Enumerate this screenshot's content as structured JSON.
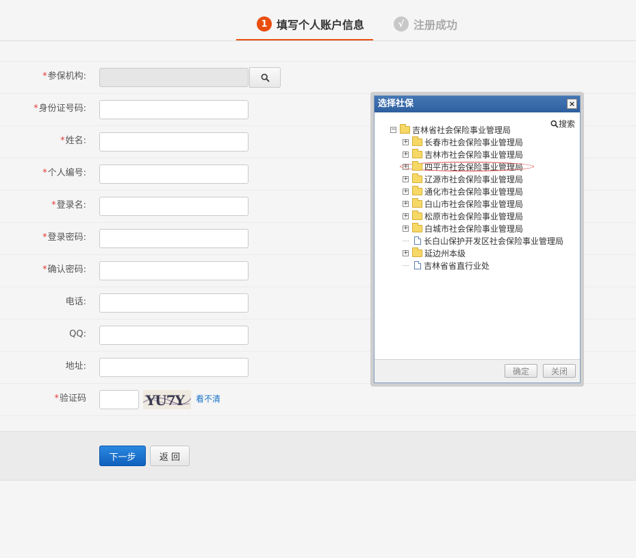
{
  "steps": [
    {
      "num": "1",
      "label": "填写个人账户信息",
      "active": true
    },
    {
      "num": "√",
      "label": "注册成功",
      "active": false
    }
  ],
  "form": {
    "required_mark": "*",
    "fields": [
      {
        "label": "参保机构:",
        "required": true,
        "value": "",
        "readonly": true,
        "has_search": true
      },
      {
        "label": "身份证号码:",
        "required": true,
        "value": ""
      },
      {
        "label": "姓名:",
        "required": true,
        "value": ""
      },
      {
        "label": "个人编号:",
        "required": true,
        "value": ""
      },
      {
        "label": "登录名:",
        "required": true,
        "value": ""
      },
      {
        "label": "登录密码:",
        "required": true,
        "value": ""
      },
      {
        "label": "确认密码:",
        "required": true,
        "value": ""
      },
      {
        "label": "电话:",
        "required": false,
        "value": ""
      },
      {
        "label": "QQ:",
        "required": false,
        "value": ""
      },
      {
        "label": "地址:",
        "required": false,
        "value": ""
      }
    ],
    "captcha": {
      "label": "验证码",
      "required": true,
      "value": "",
      "image_text": "YU7Y",
      "refresh_link": "看不清"
    }
  },
  "buttons": {
    "next": "下一步",
    "back": "返 回"
  },
  "dialog": {
    "title": "选择社保",
    "close_glyph": "×",
    "search_label": "搜索",
    "ok_label": "确定",
    "close_label": "关闭",
    "tree": {
      "root": "吉林省社会保险事业管理局",
      "children": [
        {
          "label": "长春市社会保险事业管理局",
          "type": "folder",
          "expandable": true
        },
        {
          "label": "吉林市社会保险事业管理局",
          "type": "folder",
          "expandable": true
        },
        {
          "label": "四平市社会保险事业管理局",
          "type": "folder",
          "expandable": true,
          "highlighted": true
        },
        {
          "label": "辽源市社会保险事业管理局",
          "type": "folder",
          "expandable": true
        },
        {
          "label": "通化市社会保险事业管理局",
          "type": "folder",
          "expandable": true
        },
        {
          "label": "白山市社会保险事业管理局",
          "type": "folder",
          "expandable": true
        },
        {
          "label": "松原市社会保险事业管理局",
          "type": "folder",
          "expandable": true
        },
        {
          "label": "白城市社会保险事业管理局",
          "type": "folder",
          "expandable": true
        },
        {
          "label": "长白山保护开发区社会保险事业管理局",
          "type": "file",
          "expandable": false
        },
        {
          "label": "延边州本级",
          "type": "folder",
          "expandable": true
        },
        {
          "label": "吉林省省直行业处",
          "type": "file",
          "expandable": false
        }
      ]
    }
  },
  "colors": {
    "accent": "#e94e0f",
    "primary_button": "#1565c0",
    "required": "#e4393c",
    "link": "#1a73c9",
    "dialog_title": "#3a6aa9"
  }
}
